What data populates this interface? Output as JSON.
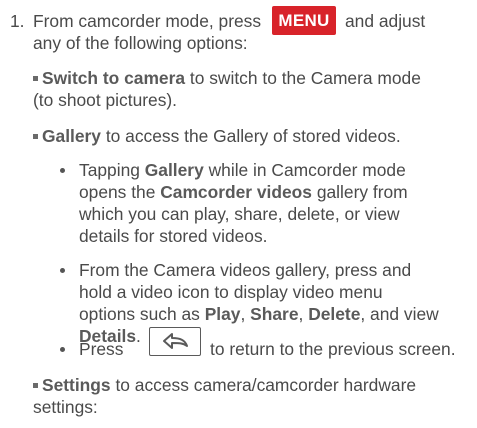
{
  "step": {
    "number": "1.",
    "line1_a": "From camcorder mode, press",
    "menu_key_label": "MENU",
    "line1_b": "and adjust",
    "line2": "any of the following options:"
  },
  "switch_camera": {
    "term": "Switch to camera",
    "line1_rest": "to switch to the Camera mode",
    "line2": "(to shoot pictures)."
  },
  "gallery": {
    "term": "Gallery",
    "rest": "to access the Gallery of stored videos.",
    "sub1": {
      "line1_a": "Tapping",
      "line1_term": "Gallery",
      "line1_b": "while in Camcorder mode",
      "line2_a": "opens the",
      "line2_term": "Camcorder videos",
      "line2_b": "gallery from",
      "line3": "which you can play, share, delete, or view",
      "line4": "details for stored videos."
    },
    "sub2": {
      "line1": "From the Camera videos gallery, press and",
      "line2": "hold a video icon to display video menu",
      "line3_a": "options such as",
      "play": "Play",
      "comma1": ",",
      "share": "Share",
      "comma2": ",",
      "delete": "Delete",
      "line3_b": ", and view",
      "details": "Details",
      "period": "."
    },
    "sub3": {
      "press": "Press",
      "back_icon": "back-arrow-icon",
      "rest": "to return to the previous screen."
    }
  },
  "settings": {
    "term": "Settings",
    "line1_rest": "to access camera/camcorder hardware",
    "line2": "settings:"
  },
  "colors": {
    "menu_key_bg": "#d8232a",
    "text": "#4a4a4a"
  }
}
